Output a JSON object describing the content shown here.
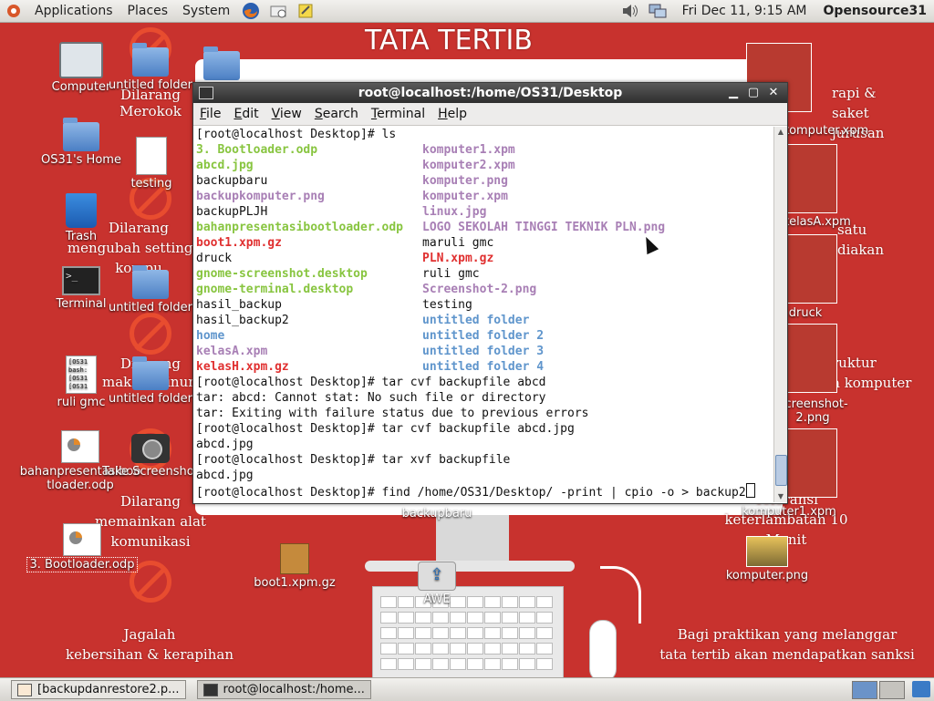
{
  "top_panel": {
    "menus": [
      "Applications",
      "Places",
      "System"
    ],
    "clock": "Fri Dec 11,  9:15 AM",
    "user": "Opensource31"
  },
  "wallpaper": {
    "heading": "TATA TERTIB",
    "notices": [
      "Dilarang\nMerokok",
      "Dilarang\nmengubah settingan kompu",
      "Dilarang\nmakan/minum",
      "Dilarang\nmemainkan alat komunikasi",
      "Jagalah\nkebersihan & kerapihan",
      "rapi &\nsaket jurusan",
      "satu\ndiakan",
      "ruktur\na komputer",
      "Toleransi\nketerlambatan 10 Menit",
      "Bagi praktikan yang melanggar\ntata tertib akan mendapatkan sanksi"
    ]
  },
  "desktop_icons": [
    {
      "label": "Computer",
      "icon": "computer-icon"
    },
    {
      "label": "untitled folder",
      "icon": "folder-icon"
    },
    {
      "label": "OS31's Home",
      "icon": "home-folder-icon"
    },
    {
      "label": "testing",
      "icon": "text-file-icon"
    },
    {
      "label": "Trash",
      "icon": "trash-icon"
    },
    {
      "label": "Terminal",
      "icon": "terminal-icon"
    },
    {
      "label": "untitled folder",
      "icon": "folder-icon"
    },
    {
      "label": "ruli gmc",
      "icon": "text-file-icon"
    },
    {
      "label": "untitled folder",
      "icon": "folder-icon"
    },
    {
      "label": "bahanpresentasibootloader.odp",
      "icon": "presentation-icon"
    },
    {
      "label": "Take Screenshot",
      "icon": "camera-icon"
    },
    {
      "label": "3. Bootloader.odp",
      "icon": "presentation-icon"
    },
    {
      "label": "boot1.xpm.gz",
      "icon": "archive-icon"
    },
    {
      "label": "AWE",
      "icon": "usb-drive-icon"
    },
    {
      "label": "backupbaru",
      "icon": "folder-icon"
    },
    {
      "label": "komputer.png",
      "icon": "image-icon"
    },
    {
      "label": "komputer1.xpm",
      "icon": "image-icon"
    },
    {
      "label": "Screenshot-2.png",
      "icon": "image-icon"
    },
    {
      "label": "kelasA.xpm",
      "icon": "image-icon"
    },
    {
      "label": "druck",
      "icon": "image-icon"
    },
    {
      "label": "komputer.xpm",
      "icon": "image-icon"
    }
  ],
  "terminal": {
    "title": "root@localhost:/home/OS31/Desktop",
    "menu": [
      "File",
      "Edit",
      "View",
      "Search",
      "Terminal",
      "Help"
    ],
    "prompt": "[root@localhost Desktop]# ",
    "ls_command": "ls",
    "ls_rows": [
      [
        {
          "t": "3. Bootloader.odp",
          "c": "odp"
        },
        {
          "t": "komputer1.xpm",
          "c": "img"
        }
      ],
      [
        {
          "t": "abcd.jpg",
          "c": "odp"
        },
        {
          "t": "komputer2.xpm",
          "c": "img"
        }
      ],
      [
        {
          "t": "backupbaru",
          "c": "plain"
        },
        {
          "t": "komputer.png",
          "c": "img"
        }
      ],
      [
        {
          "t": "backupkomputer.png",
          "c": "img"
        },
        {
          "t": "komputer.xpm",
          "c": "img"
        }
      ],
      [
        {
          "t": "backupPLJH",
          "c": "plain"
        },
        {
          "t": "linux.jpg",
          "c": "img"
        }
      ],
      [
        {
          "t": "bahanpresentasibootloader.odp",
          "c": "odp"
        },
        {
          "t": "LOGO SEKOLAH TINGGI TEKNIK PLN.png",
          "c": "img"
        }
      ],
      [
        {
          "t": "boot1.xpm.gz",
          "c": "gz"
        },
        {
          "t": "maruli gmc",
          "c": "plain"
        }
      ],
      [
        {
          "t": "druck",
          "c": "plain"
        },
        {
          "t": "PLN.xpm.gz",
          "c": "gz"
        }
      ],
      [
        {
          "t": "gnome-screenshot.desktop",
          "c": "odp"
        },
        {
          "t": "ruli gmc",
          "c": "plain"
        }
      ],
      [
        {
          "t": "gnome-terminal.desktop",
          "c": "odp"
        },
        {
          "t": "Screenshot-2.png",
          "c": "img"
        }
      ],
      [
        {
          "t": "hasil_backup",
          "c": "plain"
        },
        {
          "t": "testing",
          "c": "plain"
        }
      ],
      [
        {
          "t": "hasil_backup2",
          "c": "plain"
        },
        {
          "t": "untitled folder",
          "c": "dir"
        }
      ],
      [
        {
          "t": "home",
          "c": "dir"
        },
        {
          "t": "untitled folder 2",
          "c": "dir"
        }
      ],
      [
        {
          "t": "kelasA.xpm",
          "c": "img"
        },
        {
          "t": "untitled folder 3",
          "c": "dir"
        }
      ],
      [
        {
          "t": "kelasH.xpm.gz",
          "c": "gz"
        },
        {
          "t": "untitled folder 4",
          "c": "dir"
        }
      ]
    ],
    "after_lines": [
      "[root@localhost Desktop]# tar cvf backupfile abcd",
      "tar: abcd: Cannot stat: No such file or directory",
      "tar: Exiting with failure status due to previous errors",
      "[root@localhost Desktop]# tar cvf backupfile abcd.jpg",
      "abcd.jpg",
      "[root@localhost Desktop]# tar xvf backupfile",
      "abcd.jpg"
    ],
    "current_command": "[root@localhost Desktop]# find /home/OS31/Desktop/ -print | cpio -o > backup2"
  },
  "taskbar": {
    "tasks": [
      "[backupdanrestore2.p...",
      "root@localhost:/home..."
    ]
  },
  "colors": {
    "wallpaper": "#c8322e",
    "odp": "#88c540",
    "img": "#a87fb5",
    "gz": "#e03030",
    "dir": "#5f95cc"
  }
}
